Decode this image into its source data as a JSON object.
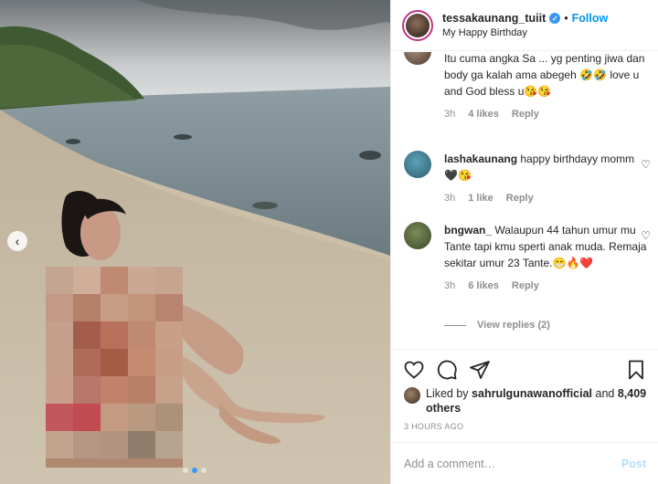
{
  "post": {
    "username": "tessakaunang_tuiit",
    "separator": "•",
    "follow_label": "Follow",
    "location": "My Happy Birthday",
    "verified_mark": "✓"
  },
  "comments": [
    {
      "text": "Itu cuma angka Sa ... yg penting jiwa dan body ga kalah ama abegeh 🤣🤣 love u and God bless u😘😘",
      "time": "3h",
      "likes": "4 likes",
      "reply": "Reply"
    },
    {
      "username": "lashakaunang",
      "text": "happy birthdayy momm 🖤😘",
      "time": "3h",
      "likes": "1 like",
      "reply": "Reply"
    },
    {
      "username": "bngwan_",
      "text": "Walaupun 44 tahun umur mu Tante tapi kmu sperti anak muda. Remaja sekitar umur 23 Tante.😁🔥❤️",
      "time": "3h",
      "likes": "6 likes",
      "reply": "Reply"
    }
  ],
  "view_replies": "View replies (2)",
  "likes": {
    "prefix": "Liked by",
    "user": "sahrulgunawanofficial",
    "and": "and",
    "count": "8,409 others"
  },
  "timestamp": "3 HOURS AGO",
  "add_comment": {
    "placeholder": "Add a comment…",
    "post_label": "Post"
  },
  "icons": {
    "like": "heart-icon",
    "comment": "comment-icon",
    "share": "send-icon",
    "save": "bookmark-icon",
    "prev": "chevron-left-icon"
  },
  "colors": {
    "accent": "#0095f6",
    "verified": "#3897f0",
    "muted": "#8e8e8e",
    "post_disabled": "#b2dffc"
  },
  "carousel": {
    "total": 3,
    "active_index": 1
  }
}
